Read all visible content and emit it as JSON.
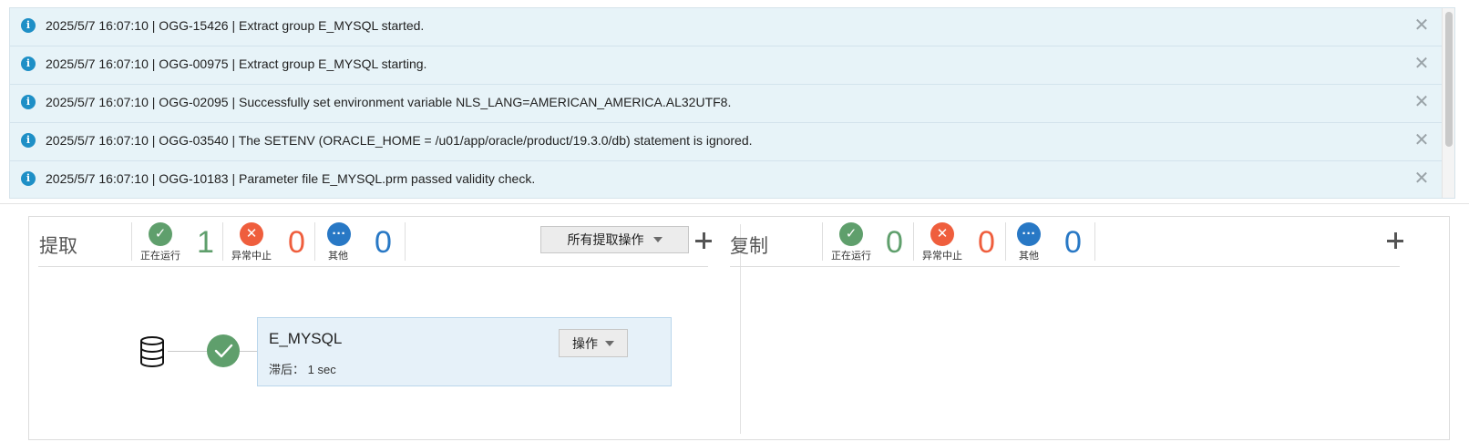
{
  "messages": [
    {
      "text": "2025/5/7 16:07:10 | OGG-15426 | Extract group E_MYSQL started.",
      "icon": "info-icon"
    },
    {
      "text": "2025/5/7 16:07:10 | OGG-00975 | Extract group E_MYSQL starting.",
      "icon": "info-icon"
    },
    {
      "text": "2025/5/7 16:07:10 | OGG-02095 | Successfully set environment variable NLS_LANG=AMERICAN_AMERICA.AL32UTF8.",
      "icon": "info-icon"
    },
    {
      "text": "2025/5/7 16:07:10 | OGG-03540 | The SETENV (ORACLE_HOME = /u01/app/oracle/product/19.3.0/db) statement is ignored.",
      "icon": "info-icon"
    },
    {
      "text": "2025/5/7 16:07:10 | OGG-10183 | Parameter file E_MYSQL.prm passed validity check.",
      "icon": "info-icon"
    }
  ],
  "extract": {
    "title": "提取",
    "running_label": "正在运行",
    "running_count": "1",
    "abended_label": "异常中止",
    "abended_count": "0",
    "other_label": "其他",
    "other_count": "0",
    "actions_button": "所有提取操作",
    "process": {
      "name": "E_MYSQL",
      "lag_label": "滞后：",
      "lag_value": "1 sec",
      "action_button": "操作"
    }
  },
  "replicat": {
    "title": "复制",
    "running_label": "正在运行",
    "running_count": "0",
    "abended_label": "异常中止",
    "abended_count": "0",
    "other_label": "其他",
    "other_count": "0"
  },
  "colors": {
    "running": "#5f9f6c",
    "abended": "#ef5e3d",
    "other": "#2878c5",
    "info": "#1e8fc6",
    "message_bg": "#e7f3f8",
    "process_card_bg": "#e6f1f9"
  }
}
